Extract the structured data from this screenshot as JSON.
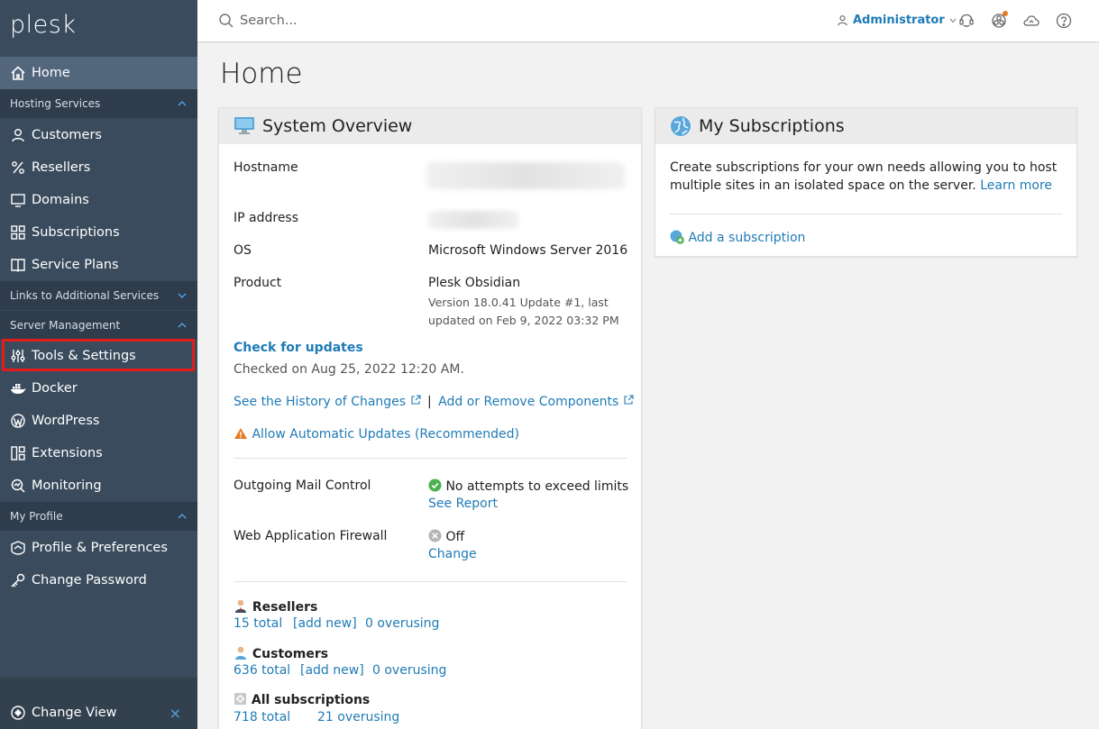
{
  "sidebar": {
    "logo": "plesk",
    "home": "Home",
    "groups": {
      "hosting": "Hosting Services",
      "links": "Links to Additional Services",
      "server": "Server Management",
      "profile": "My Profile"
    },
    "items": {
      "customers": "Customers",
      "resellers": "Resellers",
      "domains": "Domains",
      "subscriptions": "Subscriptions",
      "service_plans": "Service Plans",
      "tools_settings": "Tools & Settings",
      "docker": "Docker",
      "wordpress": "WordPress",
      "extensions": "Extensions",
      "monitoring": "Monitoring",
      "profile_prefs": "Profile & Preferences",
      "change_password": "Change Password"
    },
    "change_view": "Change View",
    "close_glyph": "×"
  },
  "topbar": {
    "search_placeholder": "Search...",
    "user": "Administrator"
  },
  "main": {
    "title": "Home",
    "system_overview": {
      "title": "System Overview",
      "hostname_label": "Hostname",
      "ip_label": "IP address",
      "os_label": "OS",
      "os_value": "Microsoft Windows Server 2016",
      "product_label": "Product",
      "product_value": "Plesk Obsidian",
      "version_line1": "Version 18.0.41 Update #1, last",
      "version_line2": "updated on Feb 9, 2022 03:32 PM",
      "check_updates": "Check for updates",
      "checked_on": "Checked on Aug 25, 2022 12:20 AM.",
      "history_link": "See the History of Changes",
      "separator": "|",
      "components_link": "Add or Remove Components",
      "auto_updates_link": "Allow Automatic Updates (Recommended)",
      "mail_label": "Outgoing Mail Control",
      "mail_value": "No attempts to exceed limits",
      "mail_link": "See Report",
      "waf_label": "Web Application Firewall",
      "waf_value": "Off",
      "waf_link": "Change",
      "resellers": {
        "title": "Resellers",
        "total": "15 total",
        "add": "[add new]",
        "overusing": "0 overusing"
      },
      "customers": {
        "title": "Customers",
        "total": "636 total",
        "add": "[add new]",
        "overusing": "0 overusing"
      },
      "subscriptions": {
        "title": "All subscriptions",
        "total": "718 total",
        "overusing": "21 overusing"
      }
    },
    "my_subscriptions": {
      "title": "My Subscriptions",
      "desc_line1": "Create subscriptions for your own needs allowing you to host",
      "desc_line2": "multiple sites in an isolated space on the server.",
      "learn_more": "Learn more",
      "add_link": "Add a subscription"
    }
  },
  "colors": {
    "sidebar_bg": "#3a4b5d",
    "sidebar_group_bg": "#2e3c4b",
    "active_bg": "#52667c",
    "link": "#1f7bb6",
    "highlight": "#e21b1b",
    "success": "#4caf50",
    "warning": "#e37c20"
  }
}
